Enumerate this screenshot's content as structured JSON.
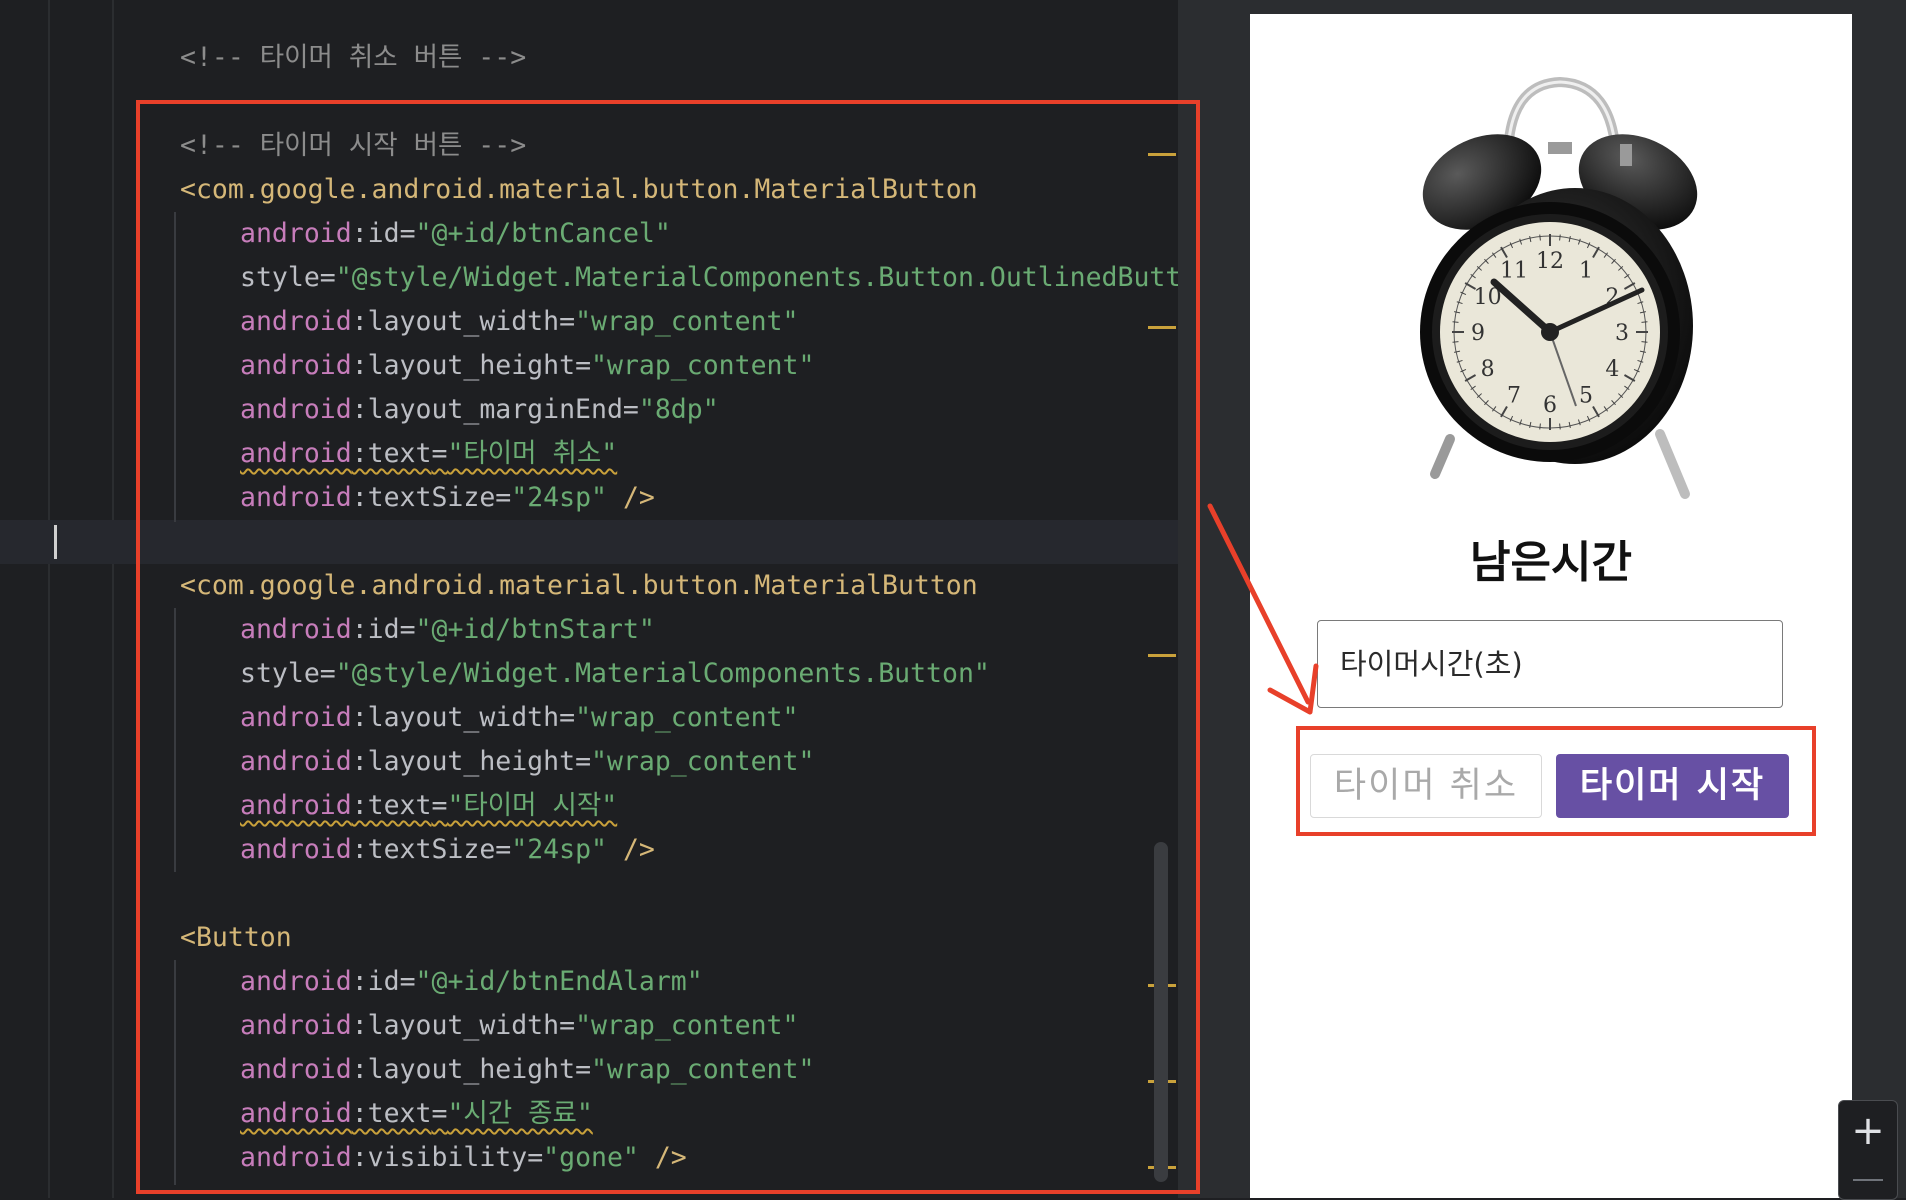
{
  "editor": {
    "lines": [
      {
        "segments": [
          {
            "cls": "c-comment",
            "text": "<!-- 타이머 취소 버튼 -->"
          }
        ]
      },
      {
        "segments": [
          {
            "cls": "c-comment",
            "text": "<!-- 타이머 시작 버튼 -->"
          }
        ]
      },
      {
        "segments": [
          {
            "cls": "c-tag",
            "text": "<com.google.android.material.button.MaterialButton"
          }
        ]
      },
      {
        "segments": [
          {
            "cls": "c-ns",
            "text": "android"
          },
          {
            "cls": "c-attr",
            "text": ":id"
          },
          {
            "cls": "c-eq",
            "text": "="
          },
          {
            "cls": "c-str",
            "text": "\"@+id/btnCancel\""
          }
        ]
      },
      {
        "segments": [
          {
            "cls": "c-attr",
            "text": "style"
          },
          {
            "cls": "c-eq",
            "text": "="
          },
          {
            "cls": "c-str",
            "text": "\"@style/Widget.MaterialComponents.Button.OutlinedButto"
          }
        ]
      },
      {
        "segments": [
          {
            "cls": "c-ns",
            "text": "android"
          },
          {
            "cls": "c-attr",
            "text": ":layout_width"
          },
          {
            "cls": "c-eq",
            "text": "="
          },
          {
            "cls": "c-str",
            "text": "\"wrap_content\""
          }
        ]
      },
      {
        "segments": [
          {
            "cls": "c-ns",
            "text": "android"
          },
          {
            "cls": "c-attr",
            "text": ":layout_height"
          },
          {
            "cls": "c-eq",
            "text": "="
          },
          {
            "cls": "c-str",
            "text": "\"wrap_content\""
          }
        ]
      },
      {
        "segments": [
          {
            "cls": "c-ns",
            "text": "android"
          },
          {
            "cls": "c-attr",
            "text": ":layout_marginEnd"
          },
          {
            "cls": "c-eq",
            "text": "="
          },
          {
            "cls": "c-str",
            "text": "\"8dp\""
          }
        ]
      },
      {
        "segments": [
          {
            "cls": "c-ns wavy",
            "text": "android"
          },
          {
            "cls": "c-attr wavy",
            "text": ":text"
          },
          {
            "cls": "c-eq wavy",
            "text": "="
          },
          {
            "cls": "c-str wavy",
            "text": "\"타이머 취소\""
          }
        ]
      },
      {
        "segments": [
          {
            "cls": "c-ns",
            "text": "android"
          },
          {
            "cls": "c-attr",
            "text": ":textSize"
          },
          {
            "cls": "c-eq",
            "text": "="
          },
          {
            "cls": "c-str",
            "text": "\"24sp\""
          },
          {
            "cls": "c-tag",
            "text": " />"
          }
        ]
      },
      {
        "segments": []
      },
      {
        "segments": [
          {
            "cls": "c-tag",
            "text": "<com.google.android.material.button.MaterialButton"
          }
        ]
      },
      {
        "segments": [
          {
            "cls": "c-ns",
            "text": "android"
          },
          {
            "cls": "c-attr",
            "text": ":id"
          },
          {
            "cls": "c-eq",
            "text": "="
          },
          {
            "cls": "c-str",
            "text": "\"@+id/btnStart\""
          }
        ]
      },
      {
        "segments": [
          {
            "cls": "c-attr",
            "text": "style"
          },
          {
            "cls": "c-eq",
            "text": "="
          },
          {
            "cls": "c-str",
            "text": "\"@style/Widget.MaterialComponents.Button\""
          }
        ]
      },
      {
        "segments": [
          {
            "cls": "c-ns",
            "text": "android"
          },
          {
            "cls": "c-attr",
            "text": ":layout_width"
          },
          {
            "cls": "c-eq",
            "text": "="
          },
          {
            "cls": "c-str",
            "text": "\"wrap_content\""
          }
        ]
      },
      {
        "segments": [
          {
            "cls": "c-ns",
            "text": "android"
          },
          {
            "cls": "c-attr",
            "text": ":layout_height"
          },
          {
            "cls": "c-eq",
            "text": "="
          },
          {
            "cls": "c-str",
            "text": "\"wrap_content\""
          }
        ]
      },
      {
        "segments": [
          {
            "cls": "c-ns wavy",
            "text": "android"
          },
          {
            "cls": "c-attr wavy",
            "text": ":text"
          },
          {
            "cls": "c-eq wavy",
            "text": "="
          },
          {
            "cls": "c-str wavy",
            "text": "\"타이머 시작\""
          }
        ]
      },
      {
        "segments": [
          {
            "cls": "c-ns",
            "text": "android"
          },
          {
            "cls": "c-attr",
            "text": ":textSize"
          },
          {
            "cls": "c-eq",
            "text": "="
          },
          {
            "cls": "c-str",
            "text": "\"24sp\""
          },
          {
            "cls": "c-tag",
            "text": " />"
          }
        ]
      },
      {
        "segments": []
      },
      {
        "segments": [
          {
            "cls": "c-tag",
            "text": "<Button"
          }
        ]
      },
      {
        "segments": [
          {
            "cls": "c-ns",
            "text": "android"
          },
          {
            "cls": "c-attr",
            "text": ":id"
          },
          {
            "cls": "c-eq",
            "text": "="
          },
          {
            "cls": "c-str",
            "text": "\"@+id/btnEndAlarm\""
          }
        ]
      },
      {
        "segments": [
          {
            "cls": "c-ns",
            "text": "android"
          },
          {
            "cls": "c-attr",
            "text": ":layout_width"
          },
          {
            "cls": "c-eq",
            "text": "="
          },
          {
            "cls": "c-str",
            "text": "\"wrap_content\""
          }
        ]
      },
      {
        "segments": [
          {
            "cls": "c-ns",
            "text": "android"
          },
          {
            "cls": "c-attr",
            "text": ":layout_height"
          },
          {
            "cls": "c-eq",
            "text": "="
          },
          {
            "cls": "c-str",
            "text": "\"wrap_content\""
          }
        ]
      },
      {
        "segments": [
          {
            "cls": "c-ns wavy",
            "text": "android"
          },
          {
            "cls": "c-attr wavy",
            "text": ":text"
          },
          {
            "cls": "c-eq wavy",
            "text": "="
          },
          {
            "cls": "c-str wavy",
            "text": "\"시간 종료\""
          }
        ]
      },
      {
        "segments": [
          {
            "cls": "c-ns",
            "text": "android"
          },
          {
            "cls": "c-attr",
            "text": ":visibility"
          },
          {
            "cls": "c-eq",
            "text": "="
          },
          {
            "cls": "c-str",
            "text": "\"gone\""
          },
          {
            "cls": "c-tag",
            "text": " />"
          }
        ]
      }
    ]
  },
  "preview": {
    "title": "남은시간",
    "timer_input": {
      "placeholder": "타이머시간(초)"
    },
    "cancel_button": "타이머 취소",
    "start_button": "타이머 시작",
    "clock_numerals": [
      "12",
      "1",
      "2",
      "3",
      "4",
      "5",
      "6",
      "7",
      "8",
      "9",
      "10",
      "11"
    ],
    "start_button_color": "#6750a4"
  },
  "zoom": {
    "plus": "+"
  },
  "annotation_color": "#e8402a"
}
